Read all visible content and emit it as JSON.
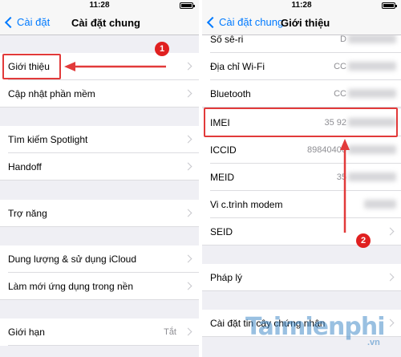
{
  "left": {
    "status_time": "11:28",
    "back_label": "Cài đặt",
    "title": "Cài đặt chung",
    "rows": [
      {
        "label": "Giới thiệu"
      },
      {
        "label": "Cập nhật phần mềm"
      },
      {
        "label": "Tìm kiếm Spotlight"
      },
      {
        "label": "Handoff"
      },
      {
        "label": "Trợ năng"
      },
      {
        "label": "Dung lượng & sử dụng iCloud"
      },
      {
        "label": "Làm mới ứng dụng trong nền"
      },
      {
        "label": "Giới hạn",
        "value": "Tắt"
      }
    ]
  },
  "right": {
    "status_time": "11:28",
    "back_label": "Cài đặt chung",
    "title": "Giới thiệu",
    "rows": [
      {
        "label": "Số sê-ri",
        "value": "D"
      },
      {
        "label": "Địa chỉ Wi-Fi",
        "value": "CC"
      },
      {
        "label": "Bluetooth",
        "value": "CC"
      },
      {
        "label": "IMEI",
        "value": "35 92"
      },
      {
        "label": "ICCID",
        "value": "89840406"
      },
      {
        "label": "MEID",
        "value": "35"
      },
      {
        "label": "Vi c.trình modem",
        "value": ""
      },
      {
        "label": "SEID"
      },
      {
        "label": "Pháp lý"
      },
      {
        "label": "Cài đặt tin cậy chứng nhận"
      }
    ]
  },
  "annotations": {
    "step1": "1",
    "step2": "2",
    "color": "#e23a3a"
  },
  "watermark": {
    "text": "Taimienphi",
    "suffix": ".vn"
  }
}
